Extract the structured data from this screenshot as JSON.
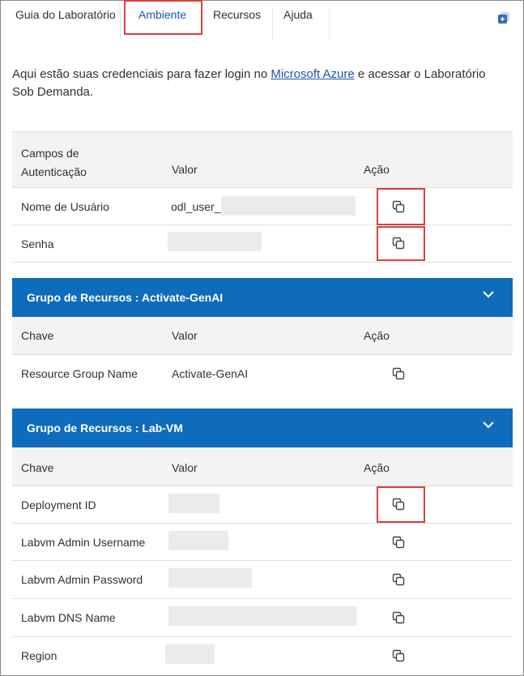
{
  "tabs": [
    {
      "label": "Guia do Laboratório"
    },
    {
      "label": "Ambiente"
    },
    {
      "label": "Recursos"
    },
    {
      "label": "Ajuda"
    }
  ],
  "intro": {
    "before": "Aqui estão suas credenciais para fazer login no ",
    "link": "Microsoft Azure",
    "after": " e acessar o Laboratório Sob Demanda."
  },
  "auth": {
    "headers": {
      "field": "Campos de Autenticação",
      "value": "Valor",
      "action": "Ação"
    },
    "rows": [
      {
        "field": "Nome de Usuário",
        "value": "odl_user_"
      },
      {
        "field": "Senha",
        "value": ""
      }
    ]
  },
  "groups": [
    {
      "title": "Grupo de Recursos : Activate-GenAI",
      "headers": {
        "key": "Chave",
        "value": "Valor",
        "action": "Ação"
      },
      "rows": [
        {
          "key": "Resource Group Name",
          "value": "Activate-GenAI"
        }
      ]
    },
    {
      "title": "Grupo de Recursos : Lab-VM",
      "headers": {
        "key": "Chave",
        "value": "Valor",
        "action": "Ação"
      },
      "rows": [
        {
          "key": "Deployment ID",
          "value": ""
        },
        {
          "key": "Labvm Admin Username",
          "value": ""
        },
        {
          "key": "Labvm Admin Password",
          "value": ""
        },
        {
          "key": "Labvm DNS Name",
          "value": ""
        },
        {
          "key": "Region",
          "value": ""
        }
      ]
    }
  ],
  "colors": {
    "accent": "#0f6cbd",
    "highlight": "#d9403f",
    "link": "#1a57a8"
  }
}
